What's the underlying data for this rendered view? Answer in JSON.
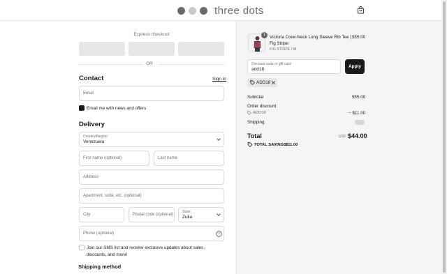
{
  "brand": {
    "name": "three dots",
    "dot_colors": [
      "#6b6b6b",
      "#c8c8c8",
      "#6b6b6b"
    ]
  },
  "express": {
    "label": "Express checkout",
    "or": "OR"
  },
  "contact": {
    "title": "Contact",
    "signin": "Sign in",
    "email_placeholder": "Email",
    "news_label": "Email me with news and offers",
    "news_checked": true
  },
  "delivery": {
    "title": "Delivery",
    "country_label": "Country/Region",
    "country_value": "Venezuela",
    "first_name": "First name (optional)",
    "last_name": "Last name",
    "address": "Address",
    "apartment": "Apartment, suite, etc. (optional)",
    "city": "City",
    "postal": "Postal code (optional)",
    "state_label": "State",
    "state_value": "Zulia",
    "phone": "Phone (optional)",
    "sms_label": "Join our SMS list and receive exclusive updates about sales, discounts, and more!",
    "sms_checked": false
  },
  "shipping_method": {
    "title": "Shipping method"
  },
  "product": {
    "title_line1": "Victoria Crew-Neck Long Sleeve Rib Tee |",
    "title_line2": "Fig Stripe",
    "variant": "FIG STRIPE / M",
    "price": "$55.00",
    "quantity": "1"
  },
  "discount": {
    "label": "Discount code or gift card",
    "value": "add18",
    "apply": "Apply",
    "tag": "ADD18"
  },
  "summary": {
    "subtotal_label": "Subtotal",
    "subtotal": "$55.00",
    "order_discount_label": "Order discount",
    "discount_code": "ADD18",
    "discount_amount": "− $11.00",
    "shipping_label": "Shipping",
    "total_label": "Total",
    "currency": "USD",
    "total": "$44.00",
    "savings_label": "TOTAL SAVINGS",
    "savings": "$11.00"
  }
}
